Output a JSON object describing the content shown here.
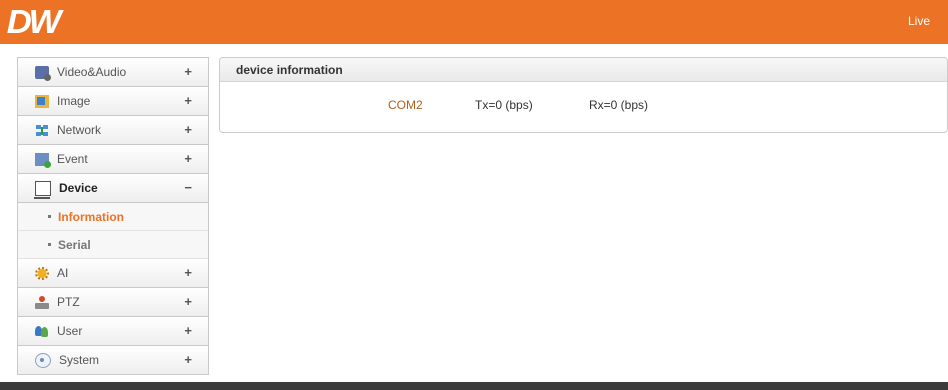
{
  "header": {
    "logo": "DW",
    "live_label": "Live"
  },
  "sidebar": {
    "items": [
      {
        "label": "Video&Audio",
        "sign": "+",
        "icon": "video-audio-icon"
      },
      {
        "label": "Image",
        "sign": "+",
        "icon": "image-icon"
      },
      {
        "label": "Network",
        "sign": "+",
        "icon": "network-icon"
      },
      {
        "label": "Event",
        "sign": "+",
        "icon": "event-icon"
      },
      {
        "label": "Device",
        "sign": "−",
        "icon": "device-icon",
        "subitems": [
          {
            "label": "Information",
            "active": true
          },
          {
            "label": "Serial",
            "active": false
          }
        ]
      },
      {
        "label": "AI",
        "sign": "+",
        "icon": "ai-icon"
      },
      {
        "label": "PTZ",
        "sign": "+",
        "icon": "ptz-icon"
      },
      {
        "label": "User",
        "sign": "+",
        "icon": "user-icon"
      },
      {
        "label": "System",
        "sign": "+",
        "icon": "system-icon"
      }
    ]
  },
  "panel": {
    "title": "device information",
    "port": "COM2",
    "tx": "Tx=0 (bps)",
    "rx": "Rx=0 (bps)"
  },
  "colors": {
    "accent": "#ec7325",
    "footer": "#3b3b3b"
  }
}
